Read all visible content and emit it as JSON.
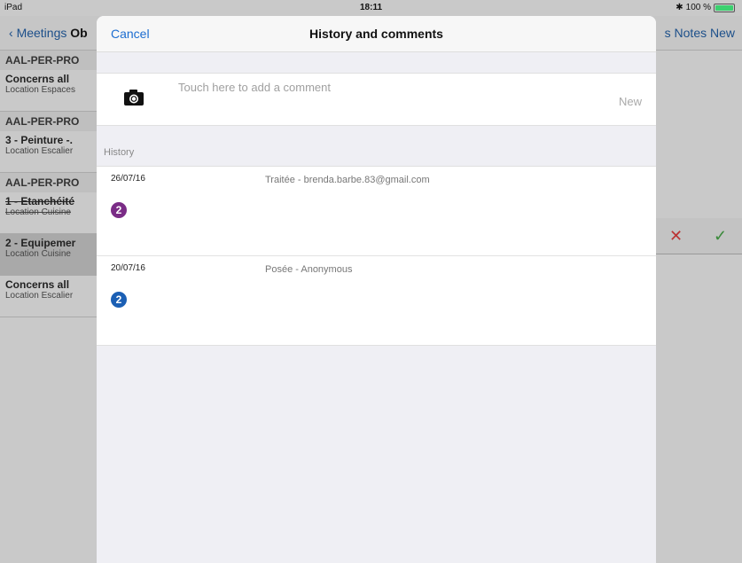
{
  "status_bar": {
    "carrier": "iPad",
    "time": "18:11",
    "battery": "100 %"
  },
  "background": {
    "back_label": "Meetings",
    "title_fragment": "Ob",
    "right_items": "s Notes New",
    "sections": [
      {
        "header": "AAL-PER-PRO",
        "rows": [
          {
            "title": "Concerns all",
            "subtitle": "Location Espaces",
            "strike": false,
            "selected": false
          }
        ]
      },
      {
        "header": "AAL-PER-PRO",
        "rows": [
          {
            "title": "3 - Peinture -.",
            "subtitle": "Location Escalier",
            "strike": false,
            "selected": false
          }
        ]
      },
      {
        "header": "AAL-PER-PRO",
        "rows": [
          {
            "title": "1 - Etanchéité",
            "subtitle": "Location Cuisine",
            "strike": true,
            "selected": false
          },
          {
            "title": "2 - Equipemer",
            "subtitle": "Location Cuisine",
            "strike": false,
            "selected": true
          },
          {
            "title": "Concerns all",
            "subtitle": "Location Escalier",
            "strike": false,
            "selected": false
          }
        ]
      }
    ],
    "reject_symbol": "✕",
    "accept_symbol": "✓"
  },
  "modal": {
    "cancel_label": "Cancel",
    "title": "History and comments",
    "comment_placeholder": "Touch here to add a comment",
    "new_label": "New",
    "history_label": "History",
    "history": [
      {
        "date": "26/07/16",
        "text": "Traitée - brenda.barbe.83@gmail.com",
        "badge": "2",
        "badge_color": "#7a2c86"
      },
      {
        "date": "20/07/16",
        "text": "Posée - Anonymous",
        "badge": "2",
        "badge_color": "#1b5fb4"
      }
    ]
  }
}
